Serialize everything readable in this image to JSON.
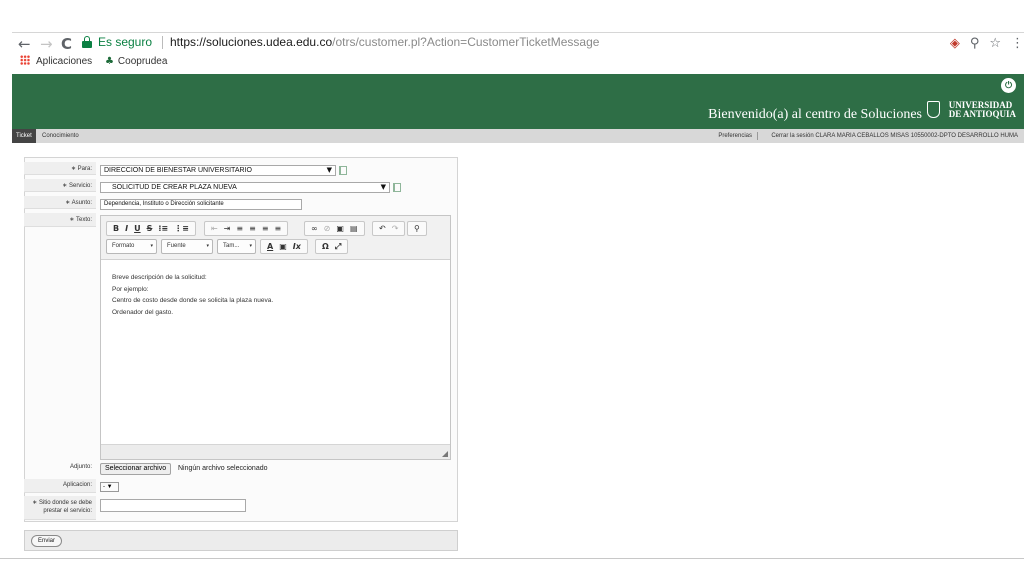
{
  "browser": {
    "back": "←",
    "forward": "→",
    "reload": "C",
    "secure_label": "Es seguro",
    "url_host": "https://soluciones.udea.edu.co",
    "url_path": "/otrs/customer.pl?Action=CustomerTicketMessage",
    "icons": [
      "shield-blocked-icon",
      "zoom-icon",
      "star-icon",
      "menu-icon"
    ],
    "zoom_glyph": "⚲",
    "star_glyph": "☆",
    "menu_glyph": "⋮",
    "bookmarks": [
      {
        "label": "Aplicaciones",
        "icon": "apps-grid-icon"
      },
      {
        "label": "Cooprudea",
        "icon": "cooprudea-icon"
      }
    ]
  },
  "header": {
    "welcome": "Bienvenido(a) al centro de Soluciones",
    "university_line1": "UNIVERSIDAD",
    "university_line2": "DE ANTIOQUIA",
    "logout_glyph": "⏻",
    "colors": {
      "brand": "#2e6e46"
    }
  },
  "nav": {
    "tab_ticket": "Ticket",
    "tab_knowledge": "Conocimiento",
    "preferences": "Preferencias",
    "session": "Cerrar la sesión CLARA MARIA CEBALLOS MISAS 10550002-DPTO DESARROLLO HUMA"
  },
  "form": {
    "para_label": "∗ Para:",
    "para_value": "DIRECCION DE BIENESTAR UNIVERSITARIO",
    "servicio_label": "∗ Servicio:",
    "servicio_value": "SOLICITUD DE CREAR PLAZA NUEVA",
    "asunto_label": "∗ Asunto:",
    "asunto_value": "Dependencia, Instituto o Dirección solicitante",
    "texto_label": "∗ Texto:",
    "select_arrow": "▼",
    "editor": {
      "row1_group1": [
        "B",
        "I",
        "U",
        "S",
        "⁝≡",
        "⋮≡"
      ],
      "row1_group2": [
        "⇤",
        "⇥",
        "≡",
        "≡",
        "≡",
        "≡"
      ],
      "row1_group3": [
        "∞",
        "⊘",
        "▣",
        "▤"
      ],
      "row1_group4": [
        "↶",
        "↷"
      ],
      "row1_group5": [
        "⚲"
      ],
      "format_combo": "Formato",
      "font_combo": "Fuente",
      "size_combo": "Tam...",
      "row2_group": [
        "A",
        "▣",
        "Ix"
      ],
      "row2_group_b": [
        "Ω",
        "⤢"
      ],
      "combo_carat": "▾",
      "content_lines": [
        "Breve descripción de la solicitud:",
        "Por ejemplo:",
        "Centro de costo desde donde se solicita la plaza nueva.",
        "Ordenador del gasto."
      ]
    },
    "adjunto_label": "Adjunto:",
    "file_button": "Seleccionar archivo",
    "file_status": "Ningún archivo seleccionado",
    "aplicacion_label": "Aplicacion:",
    "aplicacion_value": "- ▼",
    "sitio_label_1": "∗ Sitio donde se debe",
    "sitio_label_2": "prestar el servicio:",
    "sitio_value": "",
    "submit": "Enviar"
  }
}
